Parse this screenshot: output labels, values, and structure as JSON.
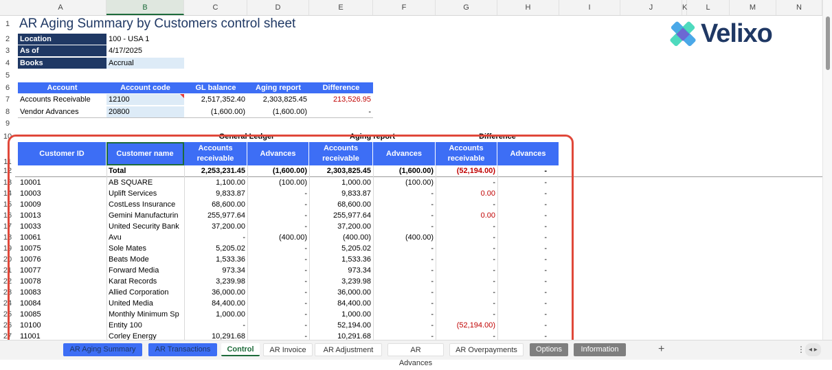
{
  "columns": [
    "A",
    "B",
    "C",
    "D",
    "E",
    "F",
    "G",
    "H",
    "I",
    "J",
    "K",
    "L",
    "M",
    "N"
  ],
  "rows": [
    "1",
    "2",
    "3",
    "4",
    "5",
    "6",
    "7",
    "8",
    "9",
    "10",
    "11",
    "12",
    "13",
    "14",
    "15",
    "16",
    "17",
    "18",
    "19",
    "20",
    "21",
    "22",
    "23",
    "24",
    "25",
    "26",
    "27"
  ],
  "title": "AR Aging Summary by Customers control sheet",
  "logo_text": "Velixo",
  "params": [
    {
      "label": "Location",
      "value": "100 - USA 1"
    },
    {
      "label": "As of",
      "value": "4/17/2025"
    },
    {
      "label": "Books",
      "value": "Accrual"
    }
  ],
  "recon": {
    "headers": [
      "Account",
      "Account code",
      "GL balance",
      "Aging report",
      "Difference"
    ],
    "rows": [
      {
        "account": "Accounts Receivable",
        "code": "12100",
        "gl": "2,517,352.40",
        "aging": "2,303,825.45",
        "diff": "213,526.95"
      },
      {
        "account": "Vendor Advances",
        "code": "20800",
        "gl": "(1,600.00)",
        "aging": "(1,600.00)",
        "diff": "-"
      }
    ]
  },
  "group_headers": [
    "General Ledger",
    "Aging report",
    "Difference"
  ],
  "detail_headers": {
    "customer_id": "Customer ID",
    "customer_name": "Customer name",
    "ar1": "Accounts",
    "ar2": "receivable",
    "adv": "Advances"
  },
  "total": {
    "label": "Total",
    "gl_ar": "2,253,231.45",
    "gl_adv": "(1,600.00)",
    "ag_ar": "2,303,825.45",
    "ag_adv": "(1,600.00)",
    "diff_ar": "(52,194.00)",
    "diff_adv": "-"
  },
  "customers": [
    {
      "id": "10001",
      "name": "AB SQUARE",
      "gl_ar": "1,100.00",
      "gl_adv": "(100.00)",
      "ag_ar": "1,000.00",
      "ag_adv": "(100.00)",
      "diff_ar": "-",
      "diff_adv": "-"
    },
    {
      "id": "10003",
      "name": "Uplift Services",
      "gl_ar": "9,833.87",
      "gl_adv": "-",
      "ag_ar": "9,833.87",
      "ag_adv": "-",
      "diff_ar": "0.00",
      "diff_adv": "-"
    },
    {
      "id": "10009",
      "name": "CostLess Insurance",
      "gl_ar": "68,600.00",
      "gl_adv": "-",
      "ag_ar": "68,600.00",
      "ag_adv": "-",
      "diff_ar": "-",
      "diff_adv": "-"
    },
    {
      "id": "10013",
      "name": "Gemini Manufacturin",
      "gl_ar": "255,977.64",
      "gl_adv": "-",
      "ag_ar": "255,977.64",
      "ag_adv": "-",
      "diff_ar": "0.00",
      "diff_adv": "-"
    },
    {
      "id": "10033",
      "name": "United Security Bank",
      "gl_ar": "37,200.00",
      "gl_adv": "-",
      "ag_ar": "37,200.00",
      "ag_adv": "-",
      "diff_ar": "-",
      "diff_adv": "-"
    },
    {
      "id": "10061",
      "name": "Avu",
      "gl_ar": "-",
      "gl_adv": "(400.00)",
      "ag_ar": "(400.00)",
      "ag_adv": "(400.00)",
      "diff_ar": "-",
      "diff_adv": "-"
    },
    {
      "id": "10075",
      "name": "Sole Mates",
      "gl_ar": "5,205.02",
      "gl_adv": "-",
      "ag_ar": "5,205.02",
      "ag_adv": "-",
      "diff_ar": "-",
      "diff_adv": "-"
    },
    {
      "id": "10076",
      "name": "Beats Mode",
      "gl_ar": "1,533.36",
      "gl_adv": "-",
      "ag_ar": "1,533.36",
      "ag_adv": "-",
      "diff_ar": "-",
      "diff_adv": "-"
    },
    {
      "id": "10077",
      "name": "Forward Media",
      "gl_ar": "973.34",
      "gl_adv": "-",
      "ag_ar": "973.34",
      "ag_adv": "-",
      "diff_ar": "-",
      "diff_adv": "-"
    },
    {
      "id": "10078",
      "name": "Karat Records",
      "gl_ar": "3,239.98",
      "gl_adv": "-",
      "ag_ar": "3,239.98",
      "ag_adv": "-",
      "diff_ar": "-",
      "diff_adv": "-"
    },
    {
      "id": "10083",
      "name": "Allied Corporation",
      "gl_ar": "36,000.00",
      "gl_adv": "-",
      "ag_ar": "36,000.00",
      "ag_adv": "-",
      "diff_ar": "-",
      "diff_adv": "-"
    },
    {
      "id": "10084",
      "name": "United Media",
      "gl_ar": "84,400.00",
      "gl_adv": "-",
      "ag_ar": "84,400.00",
      "ag_adv": "-",
      "diff_ar": "-",
      "diff_adv": "-"
    },
    {
      "id": "10085",
      "name": "Monthly Minimum Sp",
      "gl_ar": "1,000.00",
      "gl_adv": "-",
      "ag_ar": "1,000.00",
      "ag_adv": "-",
      "diff_ar": "-",
      "diff_adv": "-"
    },
    {
      "id": "10100",
      "name": "Entity 100",
      "gl_ar": "-",
      "gl_adv": "-",
      "ag_ar": "52,194.00",
      "ag_adv": "-",
      "diff_ar": "(52,194.00)",
      "diff_adv": "-"
    },
    {
      "id": "11001",
      "name": "Corley Energy",
      "gl_ar": "10,291.68",
      "gl_adv": "-",
      "ag_ar": "10,291.68",
      "ag_adv": "-",
      "diff_ar": "-",
      "diff_adv": "-"
    }
  ],
  "sheet_tabs": [
    {
      "label": "AR Aging Summary",
      "style": "blue"
    },
    {
      "label": "AR Transactions",
      "style": "blue"
    },
    {
      "label": "Control",
      "style": "active"
    },
    {
      "label": "AR Invoice",
      "style": "white"
    },
    {
      "label": "AR Adjustment",
      "style": "white"
    },
    {
      "label": "AR Advances",
      "style": "white"
    },
    {
      "label": "AR Overpayments",
      "style": "white"
    },
    {
      "label": "Options",
      "style": "gray"
    },
    {
      "label": "Information",
      "style": "gray"
    }
  ],
  "add_sheet_label": "+",
  "more_label": "⋮",
  "nav_label": "◂ ▸",
  "colors": {
    "navy": "#1f3864",
    "blue": "#3d6ef5",
    "red": "#c00000",
    "highlight": "#e0483a"
  }
}
